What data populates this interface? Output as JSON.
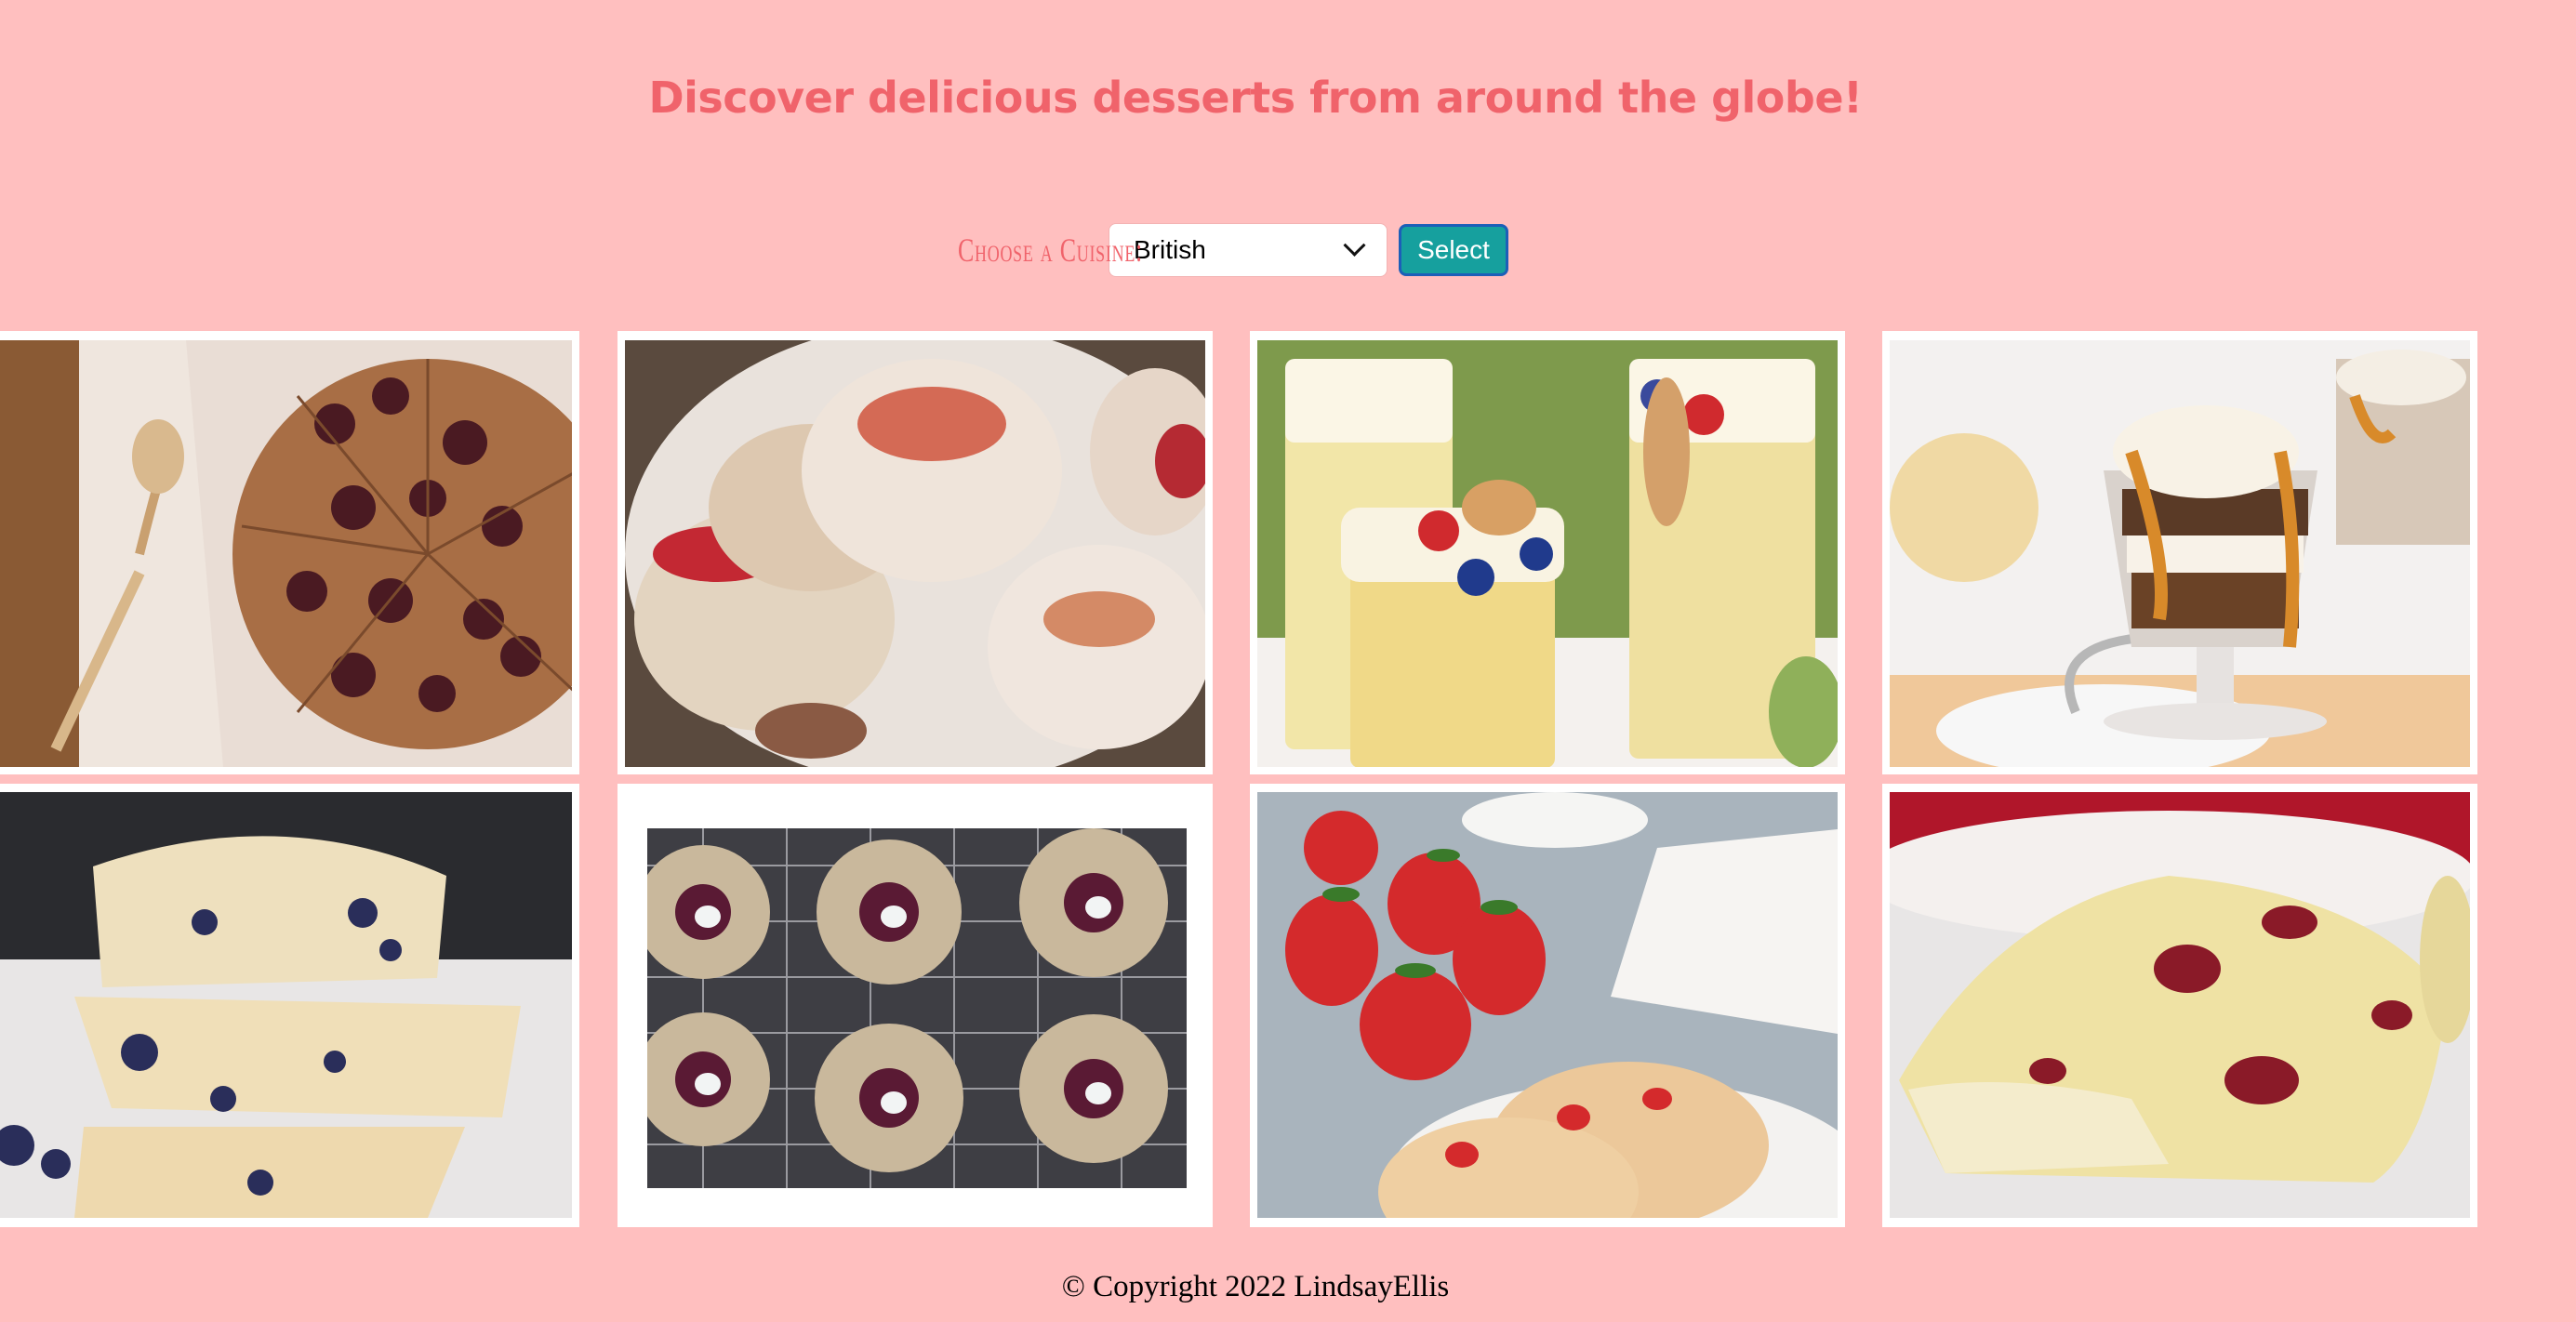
{
  "header": {
    "title": "Discover delicious desserts from around the globe!"
  },
  "cuisine_form": {
    "label": "Choose a Cuisine:",
    "selected_option": "British",
    "button_label": "Select"
  },
  "gallery": {
    "images": [
      {
        "subject": "cherry scone wedges with spoon"
      },
      {
        "subject": "jam-topped scones with powdered sugar"
      },
      {
        "subject": "berry custard trifle cups"
      },
      {
        "subject": "caramel brownie trifle glasses"
      },
      {
        "subject": "stacked blueberry almond scones"
      },
      {
        "subject": "jam thumbprint scones on cooling rack"
      },
      {
        "subject": "strawberry scones with fresh strawberries"
      },
      {
        "subject": "cranberry scone close-up"
      }
    ]
  },
  "footer": {
    "copyright": "© Copyright 2022 LindsayEllis"
  },
  "colors": {
    "background": "#ffbfbf",
    "accent": "#f0636b",
    "button": "#16a09e",
    "button_border": "#1c5fb8"
  }
}
